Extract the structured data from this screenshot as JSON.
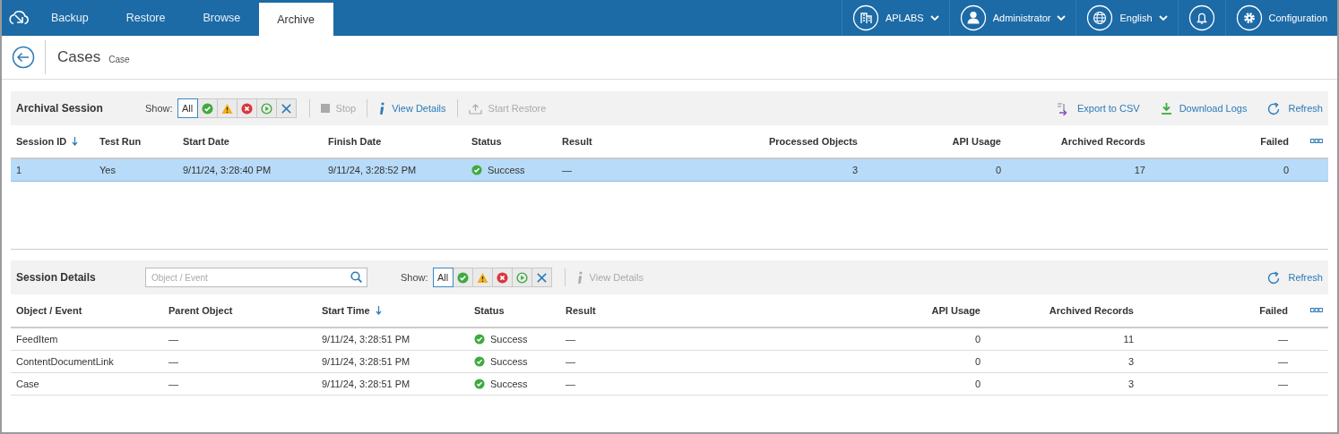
{
  "nav": {
    "tabs": [
      {
        "label": "Backup",
        "selected": false
      },
      {
        "label": "Restore",
        "selected": false
      },
      {
        "label": "Browse",
        "selected": false
      },
      {
        "label": "Archive",
        "selected": true
      }
    ],
    "menus": [
      {
        "kind": "building",
        "label": "APLABS"
      },
      {
        "kind": "user",
        "label": "Administrator"
      },
      {
        "kind": "globe",
        "label": "English"
      },
      {
        "kind": "bell"
      },
      {
        "kind": "gear",
        "label": "Configuration"
      }
    ]
  },
  "header": {
    "title": "Cases",
    "subtitle": "Case"
  },
  "archival_session": {
    "title": "Archival Session",
    "show_label": "Show:",
    "filters": [
      {
        "kind": "all",
        "label": "All",
        "selected": true
      },
      {
        "kind": "success",
        "selected": false
      },
      {
        "kind": "warning",
        "selected": false
      },
      {
        "kind": "error",
        "selected": false
      },
      {
        "kind": "running",
        "selected": false
      },
      {
        "kind": "cancelled",
        "selected": false
      }
    ],
    "actions": [
      {
        "kind": "stop",
        "label": "Stop",
        "disabled": true
      },
      {
        "kind": "info",
        "label": "View Details",
        "disabled": false
      },
      {
        "kind": "restore",
        "label": "Start Restore",
        "disabled": true
      }
    ],
    "right_actions": [
      {
        "kind": "export",
        "label": "Export to CSV"
      },
      {
        "kind": "download",
        "label": "Download Logs"
      },
      {
        "kind": "refresh",
        "label": "Refresh"
      }
    ],
    "columns": [
      {
        "label": "Session ID",
        "kind": "text",
        "sorted": true
      },
      {
        "label": "Test Run",
        "kind": "text",
        "sorted": false
      },
      {
        "label": "Start Date",
        "kind": "text",
        "sorted": false
      },
      {
        "label": "Finish Date",
        "kind": "text",
        "sorted": false
      },
      {
        "label": "Status",
        "kind": "status",
        "sorted": false
      },
      {
        "label": "Result",
        "kind": "text",
        "sorted": false
      },
      {
        "label": "Processed Objects",
        "kind": "number",
        "sorted": false
      },
      {
        "label": "API Usage",
        "kind": "number",
        "sorted": false
      },
      {
        "label": "Archived Records",
        "kind": "number",
        "sorted": false
      },
      {
        "label": "Failed",
        "kind": "number",
        "sorted": false
      }
    ],
    "rows": [
      {
        "selected": true,
        "cells": [
          "1",
          "Yes",
          "9/11/24, 3:28:40 PM",
          "9/11/24, 3:28:52 PM",
          {
            "kind": "success",
            "text": "Success"
          },
          "—",
          "3",
          "0",
          "17",
          "0"
        ]
      }
    ]
  },
  "session_details": {
    "title": "Session Details",
    "search": {
      "placeholder": "Object / Event"
    },
    "show_label": "Show:",
    "filters": [
      {
        "kind": "all",
        "label": "All",
        "selected": true
      },
      {
        "kind": "success",
        "selected": false
      },
      {
        "kind": "warning",
        "selected": false
      },
      {
        "kind": "error",
        "selected": false
      },
      {
        "kind": "running",
        "selected": false
      },
      {
        "kind": "cancelled",
        "selected": false
      }
    ],
    "actions": [
      {
        "kind": "info",
        "label": "View Details",
        "disabled": true
      }
    ],
    "right_actions": [
      {
        "kind": "refresh",
        "label": "Refresh"
      }
    ],
    "columns": [
      {
        "label": "Object / Event",
        "kind": "text",
        "sorted": false
      },
      {
        "label": "Parent Object",
        "kind": "text",
        "sorted": false
      },
      {
        "label": "Start Time",
        "kind": "text",
        "sorted": true
      },
      {
        "label": "Status",
        "kind": "status",
        "sorted": false
      },
      {
        "label": "Result",
        "kind": "text",
        "sorted": false
      },
      {
        "label": "API Usage",
        "kind": "number",
        "sorted": false
      },
      {
        "label": "Archived Records",
        "kind": "number",
        "sorted": false
      },
      {
        "label": "Failed",
        "kind": "number",
        "sorted": false
      }
    ],
    "rows": [
      {
        "selected": false,
        "cells": [
          "FeedItem",
          "—",
          "9/11/24, 3:28:51 PM",
          {
            "kind": "success",
            "text": "Success"
          },
          "—",
          "0",
          "11",
          "—"
        ]
      },
      {
        "selected": false,
        "cells": [
          "ContentDocumentLink",
          "—",
          "9/11/24, 3:28:51 PM",
          {
            "kind": "success",
            "text": "Success"
          },
          "—",
          "0",
          "3",
          "—"
        ]
      },
      {
        "selected": false,
        "cells": [
          "Case",
          "—",
          "9/11/24, 3:28:51 PM",
          {
            "kind": "success",
            "text": "Success"
          },
          "—",
          "0",
          "3",
          "—"
        ]
      }
    ]
  }
}
